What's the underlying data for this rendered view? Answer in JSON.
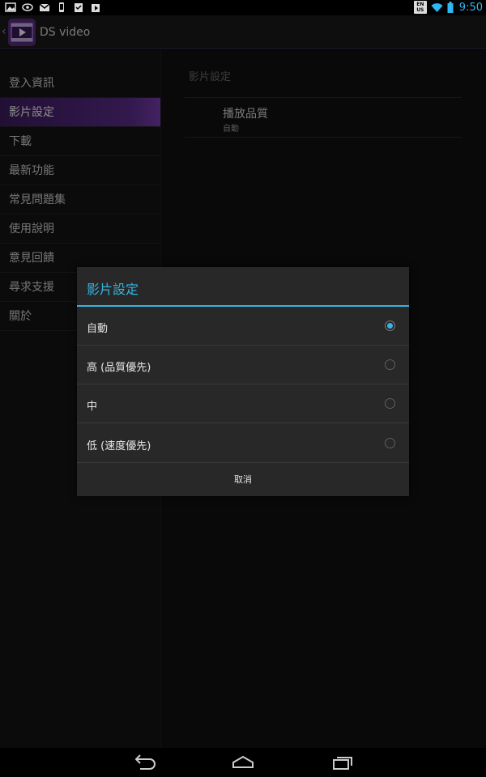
{
  "status_bar": {
    "left_icons": [
      "gallery-icon",
      "nvidia-icon",
      "gmail-icon",
      "phone-icon",
      "clipboard-check-icon",
      "play-store-icon"
    ],
    "input_badge_top": "EN",
    "input_badge_bottom": "US",
    "time": "9:50",
    "accent_color": "#33b5e5"
  },
  "action_bar": {
    "title": "DS video"
  },
  "sidebar": {
    "items": [
      {
        "label": "登入資訊"
      },
      {
        "label": "影片設定"
      },
      {
        "label": "下載"
      },
      {
        "label": "最新功能"
      },
      {
        "label": "常見問題集"
      },
      {
        "label": "使用說明"
      },
      {
        "label": "意見回饋"
      },
      {
        "label": "尋求支援"
      },
      {
        "label": "關於"
      }
    ],
    "selected_index": 1
  },
  "detail": {
    "header": "影片設定",
    "preference": {
      "title": "播放品質",
      "summary": "自動"
    }
  },
  "dialog": {
    "title": "影片設定",
    "options": [
      {
        "label": "自動",
        "selected": true
      },
      {
        "label": "高 (品質優先)",
        "selected": false
      },
      {
        "label": "中",
        "selected": false
      },
      {
        "label": "低 (速度優先)",
        "selected": false
      }
    ],
    "cancel_label": "取消"
  },
  "nav_bar": {
    "buttons": [
      "back-icon",
      "home-icon",
      "recents-icon"
    ]
  }
}
